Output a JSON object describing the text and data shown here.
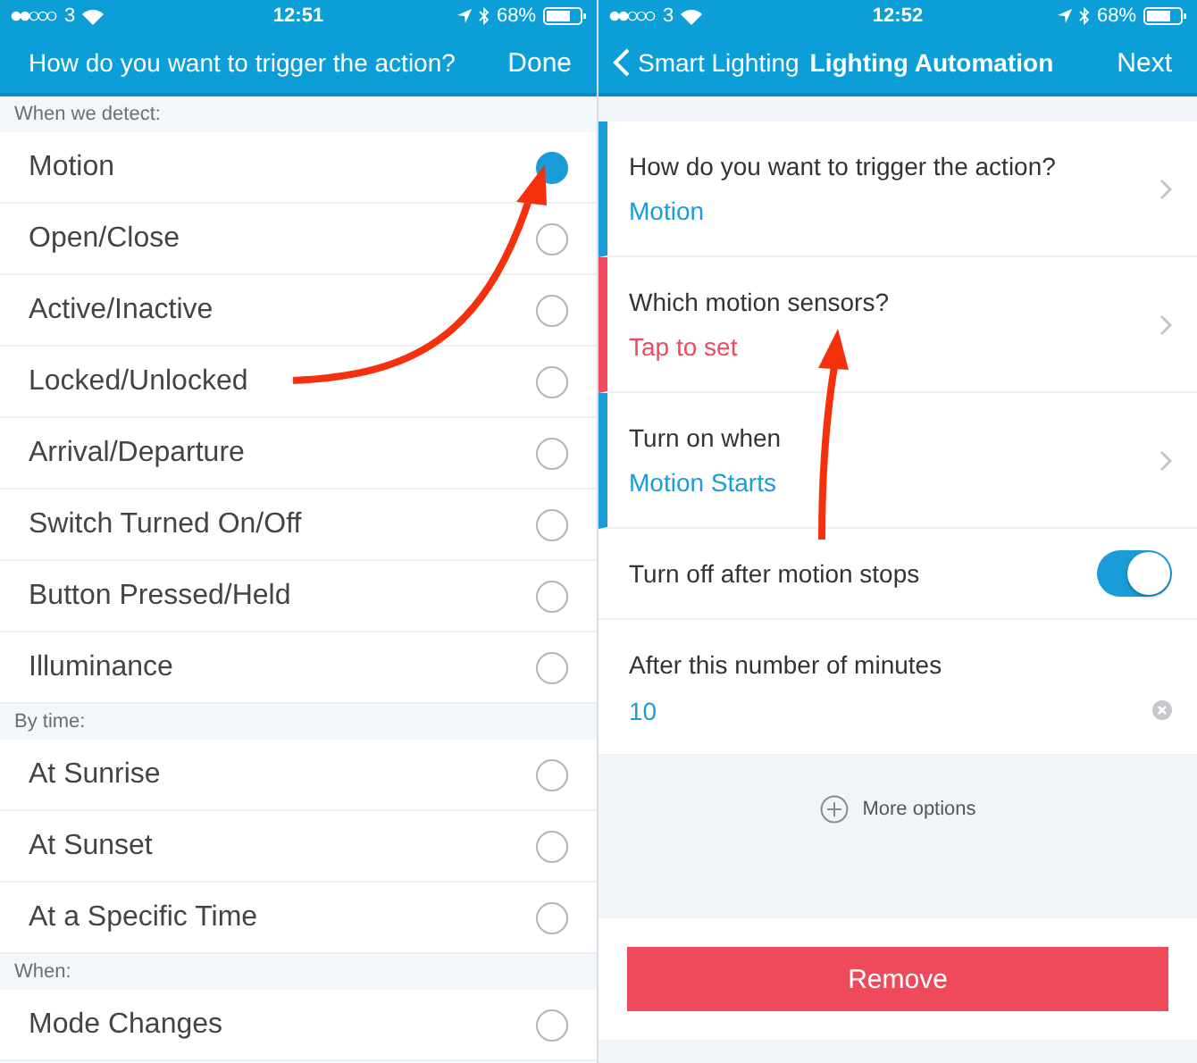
{
  "screens": [
    {
      "status_bar": {
        "carrier": "3",
        "time": "12:51",
        "battery": "68%"
      },
      "nav": {
        "title": "How do you want to trigger the action?",
        "action": "Done"
      },
      "sections": [
        {
          "header": "When we detect:",
          "options": [
            {
              "label": "Motion",
              "selected": true
            },
            {
              "label": "Open/Close",
              "selected": false
            },
            {
              "label": "Active/Inactive",
              "selected": false
            },
            {
              "label": "Locked/Unlocked",
              "selected": false
            },
            {
              "label": "Arrival/Departure",
              "selected": false
            },
            {
              "label": "Switch Turned On/Off",
              "selected": false
            },
            {
              "label": "Button Pressed/Held",
              "selected": false
            },
            {
              "label": "Illuminance",
              "selected": false
            }
          ]
        },
        {
          "header": "By time:",
          "options": [
            {
              "label": "At Sunrise",
              "selected": false
            },
            {
              "label": "At Sunset",
              "selected": false
            },
            {
              "label": "At a Specific Time",
              "selected": false
            }
          ]
        },
        {
          "header": "When:",
          "options": [
            {
              "label": "Mode Changes",
              "selected": false
            }
          ]
        }
      ]
    },
    {
      "status_bar": {
        "carrier": "3",
        "time": "12:52",
        "battery": "68%"
      },
      "nav": {
        "back": "Smart Lighting",
        "title": "Lighting Automation",
        "action": "Next"
      },
      "rows": [
        {
          "kind": "choice",
          "label": "How do you want to trigger the action?",
          "value": "Motion",
          "color": "#1a9cd8"
        },
        {
          "kind": "choice",
          "label": "Which motion sensors?",
          "value": "Tap to set",
          "color": "#ef4b5d"
        },
        {
          "kind": "choice",
          "label": "Turn on when",
          "value": "Motion Starts",
          "color": "#1a9cd8"
        },
        {
          "kind": "toggle",
          "label": "Turn off after motion stops",
          "on": true
        },
        {
          "kind": "field",
          "label": "After this number of minutes",
          "value": "10"
        }
      ],
      "more_options": "More options",
      "remove_button": "Remove"
    }
  ]
}
